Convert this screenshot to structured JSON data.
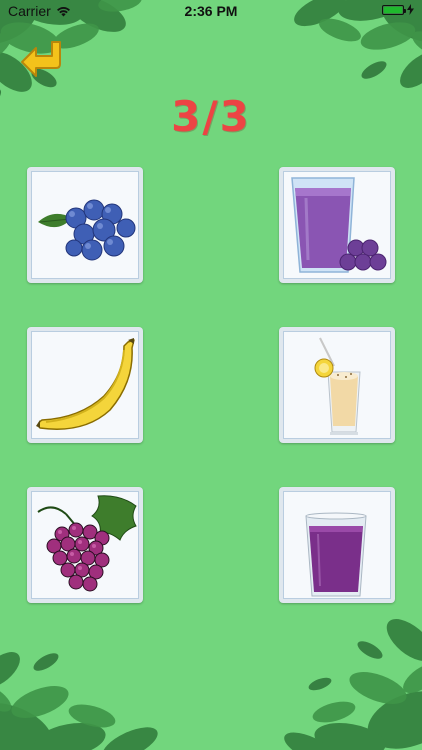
{
  "status_bar": {
    "carrier": "Carrier",
    "time": "2:36 PM",
    "icons": [
      "wifi-icon",
      "battery-icon",
      "charging-bolt-icon"
    ]
  },
  "header": {
    "back_icon": "return-arrow-icon",
    "score": "3/3"
  },
  "cards": [
    {
      "item": "blueberries",
      "column": "fruit"
    },
    {
      "item": "blueberry-smoothie",
      "column": "drink"
    },
    {
      "item": "banana",
      "column": "fruit"
    },
    {
      "item": "banana-milkshake",
      "column": "drink"
    },
    {
      "item": "grapes",
      "column": "fruit"
    },
    {
      "item": "grape-juice",
      "column": "drink"
    }
  ],
  "colors": {
    "background": "#72d67d",
    "score": "#ec4444",
    "back_arrow": "#f3c21b",
    "card_frame": "#dfe7ee"
  }
}
